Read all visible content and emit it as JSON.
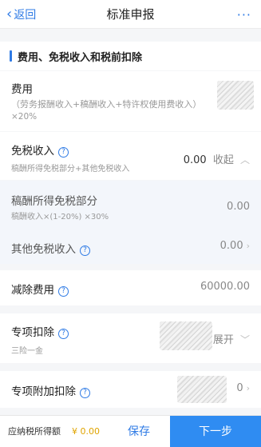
{
  "nav": {
    "back_label": "返回",
    "title": "标准申报",
    "more_label": "···"
  },
  "section": {
    "title": "费用、免税收入和税前扣除"
  },
  "expense": {
    "label": "费用",
    "hint_line1": "（劳务报酬收入+稿酬收入+特许权使用费收入）",
    "hint_line2": "×20%"
  },
  "tax_free": {
    "label": "免税收入",
    "hint": "稿酬所得免税部分+其他免税收入",
    "value": "0.00",
    "toggle_label": "收起"
  },
  "royalty_exempt": {
    "label": "稿酬所得免税部分",
    "hint": "稿酬收入×(1-20%) ×30%",
    "value": "0.00"
  },
  "other_exempt": {
    "label": "其他免税收入",
    "value": "0.00"
  },
  "deduct_expense": {
    "label": "减除费用",
    "value": "60000.00"
  },
  "special_deduction": {
    "label": "专项扣除",
    "hint": "三险一金",
    "toggle_label": "展开"
  },
  "special_additional": {
    "label": "专项附加扣除",
    "value": "0"
  },
  "footer": {
    "tax_label": "应纳税所得额",
    "tax_value": "¥ 0.00",
    "save_label": "保存",
    "next_label": "下一步"
  },
  "colors": {
    "accent": "#2f7be5",
    "primary_button": "#2f8cf2",
    "amount": "#e0a400"
  }
}
